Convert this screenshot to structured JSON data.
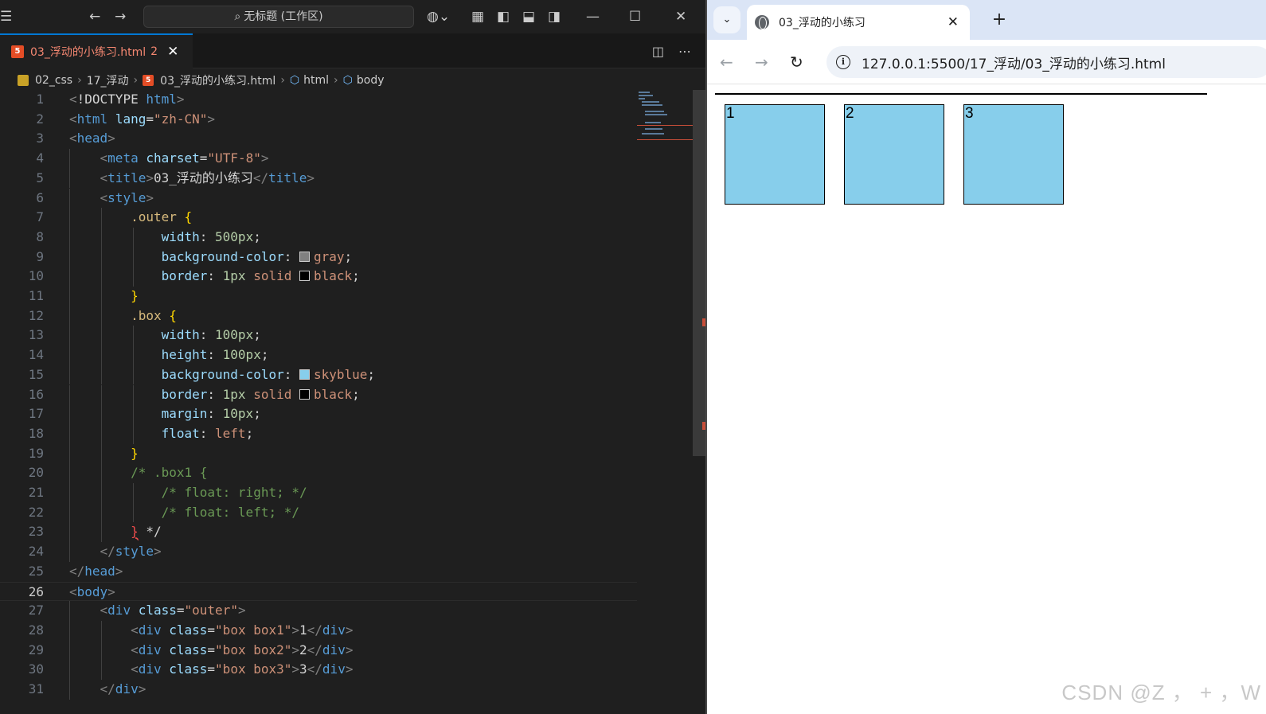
{
  "vscode": {
    "search": "无标题 (工作区)",
    "tab": {
      "filename": "03_浮动的小练习.html",
      "problems": "2",
      "close": "✕"
    },
    "breadcrumb": {
      "folder1": "02_css",
      "folder2": "17_浮动",
      "file": "03_浮动的小练习.html",
      "sym1": "html",
      "sym2": "body"
    },
    "active_line": 26,
    "lines": [
      [
        [
          "t-br",
          "<"
        ],
        [
          "t-txt",
          "!DOCTYPE "
        ],
        [
          "t-tag",
          "html"
        ],
        [
          "t-br",
          ">"
        ]
      ],
      [
        [
          "t-br",
          "<"
        ],
        [
          "t-tag",
          "html "
        ],
        [
          "t-attr",
          "lang"
        ],
        [
          "t-txt",
          "="
        ],
        [
          "t-str",
          "\"zh-CN\""
        ],
        [
          "t-br",
          ">"
        ]
      ],
      [
        [
          "t-br",
          "<"
        ],
        [
          "t-tag",
          "head"
        ],
        [
          "t-br",
          ">"
        ]
      ],
      [
        [
          "t-txt",
          "    "
        ],
        [
          "t-br",
          "<"
        ],
        [
          "t-tag",
          "meta "
        ],
        [
          "t-attr",
          "charset"
        ],
        [
          "t-txt",
          "="
        ],
        [
          "t-str",
          "\"UTF-8\""
        ],
        [
          "t-br",
          ">"
        ]
      ],
      [
        [
          "t-txt",
          "    "
        ],
        [
          "t-br",
          "<"
        ],
        [
          "t-tag",
          "title"
        ],
        [
          "t-br",
          ">"
        ],
        [
          "t-txt",
          "03_浮动的小练习"
        ],
        [
          "t-br",
          "</"
        ],
        [
          "t-tag",
          "title"
        ],
        [
          "t-br",
          ">"
        ]
      ],
      [
        [
          "t-txt",
          "    "
        ],
        [
          "t-br",
          "<"
        ],
        [
          "t-tag",
          "style"
        ],
        [
          "t-br",
          ">"
        ]
      ],
      [
        [
          "t-txt",
          "        "
        ],
        [
          "t-sel",
          ".outer "
        ],
        [
          "t-brace",
          "{"
        ]
      ],
      [
        [
          "t-txt",
          "            "
        ],
        [
          "t-prop",
          "width"
        ],
        [
          "t-txt",
          ": "
        ],
        [
          "t-num",
          "500px"
        ],
        [
          "t-txt",
          ";"
        ]
      ],
      [
        [
          "t-txt",
          "            "
        ],
        [
          "t-prop",
          "background-color"
        ],
        [
          "t-txt",
          ": "
        ],
        [
          "swatch",
          "#808080"
        ],
        [
          "t-val",
          "gray"
        ],
        [
          "t-txt",
          ";"
        ]
      ],
      [
        [
          "t-txt",
          "            "
        ],
        [
          "t-prop",
          "border"
        ],
        [
          "t-txt",
          ": "
        ],
        [
          "t-num",
          "1px "
        ],
        [
          "t-val",
          "solid "
        ],
        [
          "swatch",
          "#000000"
        ],
        [
          "t-val",
          "black"
        ],
        [
          "t-txt",
          ";"
        ]
      ],
      [
        [
          "t-txt",
          "        "
        ],
        [
          "t-brace",
          "}"
        ]
      ],
      [
        [
          "t-txt",
          "        "
        ],
        [
          "t-sel",
          ".box "
        ],
        [
          "t-brace",
          "{"
        ]
      ],
      [
        [
          "t-txt",
          "            "
        ],
        [
          "t-prop",
          "width"
        ],
        [
          "t-txt",
          ": "
        ],
        [
          "t-num",
          "100px"
        ],
        [
          "t-txt",
          ";"
        ]
      ],
      [
        [
          "t-txt",
          "            "
        ],
        [
          "t-prop",
          "height"
        ],
        [
          "t-txt",
          ": "
        ],
        [
          "t-num",
          "100px"
        ],
        [
          "t-txt",
          ";"
        ]
      ],
      [
        [
          "t-txt",
          "            "
        ],
        [
          "t-prop",
          "background-color"
        ],
        [
          "t-txt",
          ": "
        ],
        [
          "swatch",
          "#87ceeb"
        ],
        [
          "t-val",
          "skyblue"
        ],
        [
          "t-txt",
          ";"
        ]
      ],
      [
        [
          "t-txt",
          "            "
        ],
        [
          "t-prop",
          "border"
        ],
        [
          "t-txt",
          ": "
        ],
        [
          "t-num",
          "1px "
        ],
        [
          "t-val",
          "solid "
        ],
        [
          "swatch",
          "#000000"
        ],
        [
          "t-val",
          "black"
        ],
        [
          "t-txt",
          ";"
        ]
      ],
      [
        [
          "t-txt",
          "            "
        ],
        [
          "t-prop",
          "margin"
        ],
        [
          "t-txt",
          ": "
        ],
        [
          "t-num",
          "10px"
        ],
        [
          "t-txt",
          ";"
        ]
      ],
      [
        [
          "t-txt",
          "            "
        ],
        [
          "t-prop",
          "float"
        ],
        [
          "t-txt",
          ": "
        ],
        [
          "t-val",
          "left"
        ],
        [
          "t-txt",
          ";"
        ]
      ],
      [
        [
          "t-txt",
          "        "
        ],
        [
          "t-brace",
          "}"
        ]
      ],
      [
        [
          "t-txt",
          "        "
        ],
        [
          "t-com",
          "/* .box1 {"
        ]
      ],
      [
        [
          "t-txt",
          "            "
        ],
        [
          "t-com",
          "/* float: right; */"
        ]
      ],
      [
        [
          "t-txt",
          "            "
        ],
        [
          "t-com",
          "/* float: left; */"
        ]
      ],
      [
        [
          "t-txt",
          "        "
        ],
        [
          "t-err",
          "}"
        ],
        [
          "t-txt",
          " */"
        ]
      ],
      [
        [
          "t-txt",
          "    "
        ],
        [
          "t-br",
          "</"
        ],
        [
          "t-tag",
          "style"
        ],
        [
          "t-br",
          ">"
        ]
      ],
      [
        [
          "t-br",
          "</"
        ],
        [
          "t-tag",
          "head"
        ],
        [
          "t-br",
          ">"
        ]
      ],
      [
        [
          "t-br",
          "<"
        ],
        [
          "t-tag",
          "body"
        ],
        [
          "t-br",
          ">"
        ]
      ],
      [
        [
          "t-txt",
          "    "
        ],
        [
          "t-br",
          "<"
        ],
        [
          "t-tag",
          "div "
        ],
        [
          "t-attr",
          "class"
        ],
        [
          "t-txt",
          "="
        ],
        [
          "t-str",
          "\"outer\""
        ],
        [
          "t-br",
          ">"
        ]
      ],
      [
        [
          "t-txt",
          "        "
        ],
        [
          "t-br",
          "<"
        ],
        [
          "t-tag",
          "div "
        ],
        [
          "t-attr",
          "class"
        ],
        [
          "t-txt",
          "="
        ],
        [
          "t-str",
          "\"box box1\""
        ],
        [
          "t-br",
          ">"
        ],
        [
          "t-txt",
          "1"
        ],
        [
          "t-br",
          "</"
        ],
        [
          "t-tag",
          "div"
        ],
        [
          "t-br",
          ">"
        ]
      ],
      [
        [
          "t-txt",
          "        "
        ],
        [
          "t-br",
          "<"
        ],
        [
          "t-tag",
          "div "
        ],
        [
          "t-attr",
          "class"
        ],
        [
          "t-txt",
          "="
        ],
        [
          "t-str",
          "\"box box2\""
        ],
        [
          "t-br",
          ">"
        ],
        [
          "t-txt",
          "2"
        ],
        [
          "t-br",
          "</"
        ],
        [
          "t-tag",
          "div"
        ],
        [
          "t-br",
          ">"
        ]
      ],
      [
        [
          "t-txt",
          "        "
        ],
        [
          "t-br",
          "<"
        ],
        [
          "t-tag",
          "div "
        ],
        [
          "t-attr",
          "class"
        ],
        [
          "t-txt",
          "="
        ],
        [
          "t-str",
          "\"box box3\""
        ],
        [
          "t-br",
          ">"
        ],
        [
          "t-txt",
          "3"
        ],
        [
          "t-br",
          "</"
        ],
        [
          "t-tag",
          "div"
        ],
        [
          "t-br",
          ">"
        ]
      ],
      [
        [
          "t-txt",
          "    "
        ],
        [
          "t-br",
          "</"
        ],
        [
          "t-tag",
          "div"
        ],
        [
          "t-br",
          ">"
        ]
      ]
    ]
  },
  "browser": {
    "tab_title": "03_浮动的小练习",
    "tab_close": "✕",
    "new_tab": "+",
    "url": "127.0.0.1:5500/17_浮动/03_浮动的小练习.html",
    "boxes": [
      "1",
      "2",
      "3"
    ],
    "colors": {
      "box": "#87ceeb",
      "border": "#000000"
    }
  },
  "watermark": "CSDN @Z ， + ，W"
}
